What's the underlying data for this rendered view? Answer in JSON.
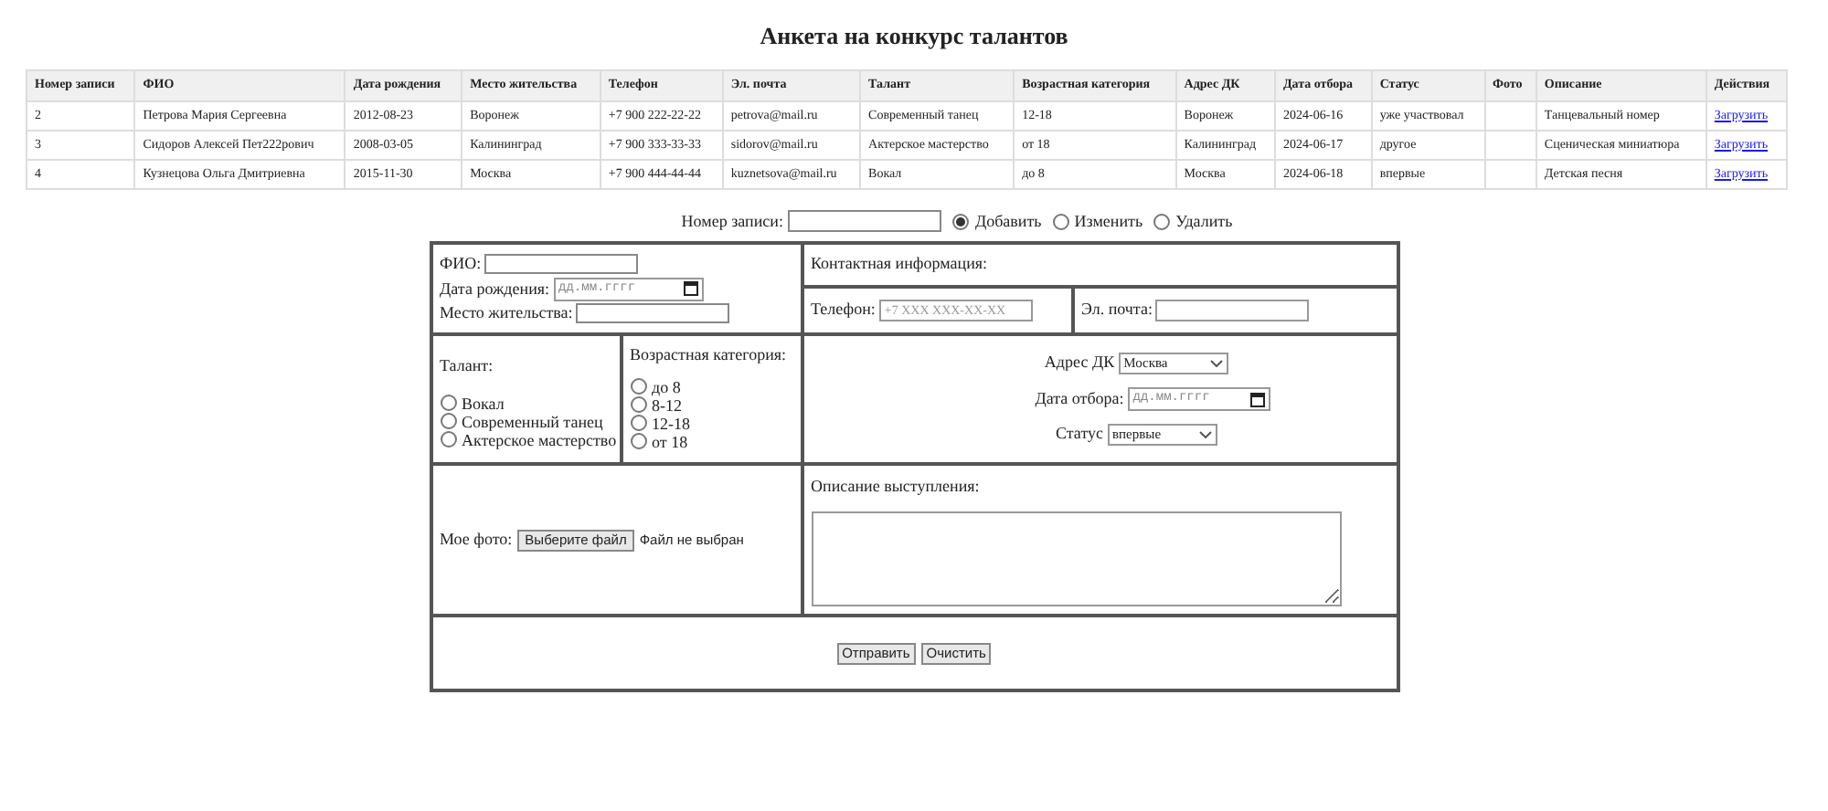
{
  "title": "Анкета на конкурс талантов",
  "table": {
    "columns": [
      "Номер записи",
      "ФИО",
      "Дата рождения",
      "Место жительства",
      "Телефон",
      "Эл. почта",
      "Талант",
      "Возрастная категория",
      "Адрес ДК",
      "Дата отбора",
      "Статус",
      "Фото",
      "Описание",
      "Действия"
    ],
    "rows": [
      {
        "cells": [
          "2",
          "Петрова Мария Сергеевна",
          "2012-08-23",
          "Воронеж",
          "+7 900 222-22-22",
          "petrova@mail.ru",
          "Современный танец",
          "12-18",
          "Воронеж",
          "2024-06-16",
          "уже участвовал",
          "",
          "Танцевальный номер"
        ],
        "action": "Загрузить"
      },
      {
        "cells": [
          "3",
          "Сидоров Алексей Пет222рович",
          "2008-03-05",
          "Калининград",
          "+7 900 333-33-33",
          "sidorov@mail.ru",
          "Актерское мастерство",
          "от 18",
          "Калининград",
          "2024-06-17",
          "другое",
          "",
          "Сценическая миниатюра"
        ],
        "action": "Загрузить"
      },
      {
        "cells": [
          "4",
          "Кузнецова Ольга Дмитриевна",
          "2015-11-30",
          "Москва",
          "+7 900 444-44-44",
          "kuznetsova@mail.ru",
          "Вокал",
          "до 8",
          "Москва",
          "2024-06-18",
          "впервые",
          "",
          "Детская песня"
        ],
        "action": "Загрузить"
      }
    ]
  },
  "record": {
    "label": "Номер записи:",
    "modes": [
      {
        "label": "Добавить",
        "selected": true
      },
      {
        "label": "Изменить",
        "selected": false
      },
      {
        "label": "Удалить",
        "selected": false
      }
    ]
  },
  "form": {
    "fio_label": "ФИО:",
    "birth_label": "Дата рождения:",
    "birth_placeholder": "дд.мм.гггг",
    "city_label": "Место жительства:",
    "contact_heading": "Контактная информация:",
    "phone_label": "Телефон:",
    "phone_placeholder": "+7 XXX XXX-XX-XX",
    "email_label": "Эл. почта:",
    "talent_heading": "Талант:",
    "talents": [
      {
        "label": "Вокал",
        "selected": false
      },
      {
        "label": "Современный танец",
        "selected": false
      },
      {
        "label": "Актерское мастерство",
        "selected": false
      }
    ],
    "age_heading": "Возрастная категория:",
    "ages": [
      {
        "label": "до 8",
        "selected": false
      },
      {
        "label": "8-12",
        "selected": false
      },
      {
        "label": "12-18",
        "selected": false
      },
      {
        "label": "от 18",
        "selected": false
      }
    ],
    "dk_label": "Адрес ДК",
    "dk_value": "Москва",
    "date_label": "Дата отбора:",
    "date_placeholder": "дд.мм.гггг",
    "status_label": "Статус",
    "status_value": "впервые",
    "photo_label": "Мое фото:",
    "file_button": "Выберите файл",
    "file_status": "Файл не выбран",
    "description_label": "Описание выступления:",
    "buttons": [
      "Отправить",
      "Очистить"
    ]
  }
}
